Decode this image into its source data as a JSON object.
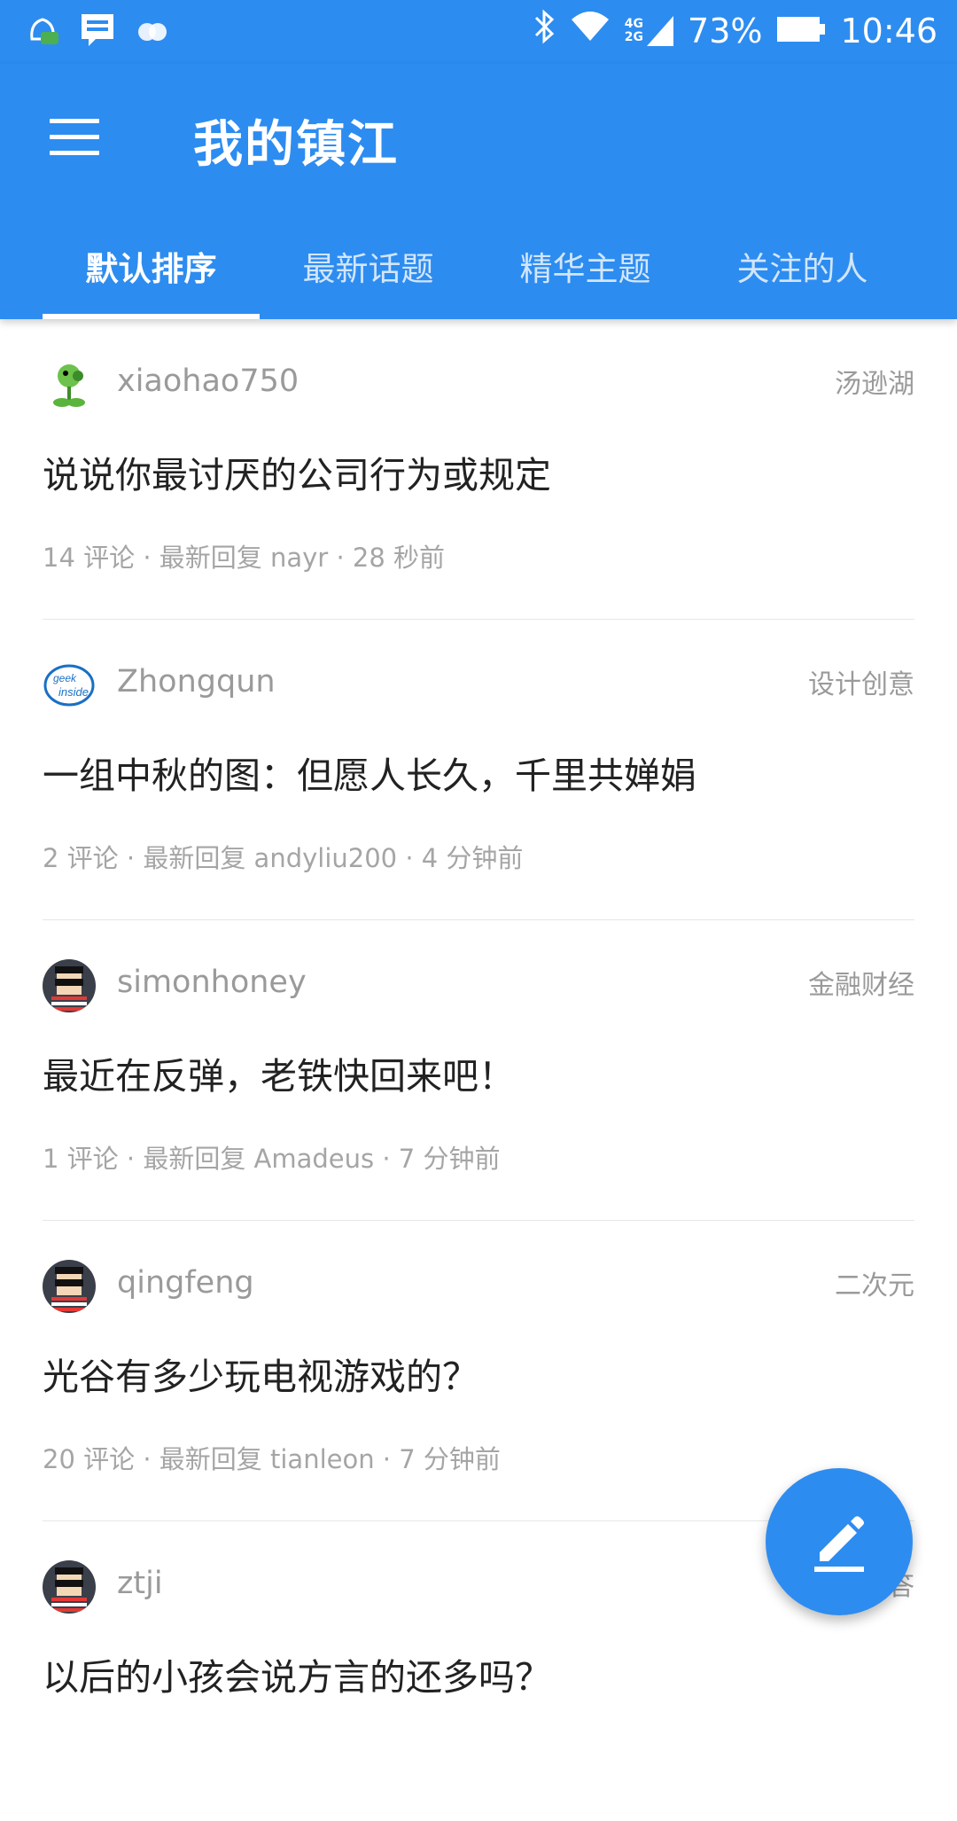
{
  "status_bar": {
    "signal_label": "4G\n2G",
    "battery": "73%",
    "time": "10:46"
  },
  "app_bar": {
    "title": "我的镇江",
    "tabs": [
      {
        "label": "默认排序"
      },
      {
        "label": "最新话题"
      },
      {
        "label": "精华主题"
      },
      {
        "label": "关注的人"
      }
    ],
    "active_tab": 0
  },
  "posts": [
    {
      "user": "xiaohao750",
      "category": "汤逊湖",
      "title": "说说你最讨厌的公司行为或规定",
      "meta": "14 评论 · 最新回复 nayr · 28 秒前",
      "avatar": "plant-avatar-icon"
    },
    {
      "user": "Zhongqun",
      "category": "设计创意",
      "title": "一组中秋的图：但愿人长久，千里共婵娟",
      "meta": "2 评论 · 最新回复 andyliu200 · 4 分钟前",
      "avatar": "geek-inside-avatar-icon"
    },
    {
      "user": "simonhoney",
      "category": "金融财经",
      "title": "最近在反弹，老铁快回来吧！",
      "meta": "1 评论 · 最新回复 Amadeus · 7 分钟前",
      "avatar": "pixel-face-avatar-icon"
    },
    {
      "user": "qingfeng",
      "category": "二次元",
      "title": "光谷有多少玩电视游戏的？",
      "meta": "20 评论 · 最新回复 tianleon · 7 分钟前",
      "avatar": "pixel-face-avatar-icon"
    },
    {
      "user": "ztji",
      "category": "答",
      "title": "以后的小孩会说方言的还多吗？",
      "meta": "",
      "avatar": "pixel-face-avatar-icon"
    }
  ],
  "colors": {
    "primary": "#2d8cf0",
    "text_primary": "#222222",
    "text_secondary": "#9a9a9a"
  }
}
